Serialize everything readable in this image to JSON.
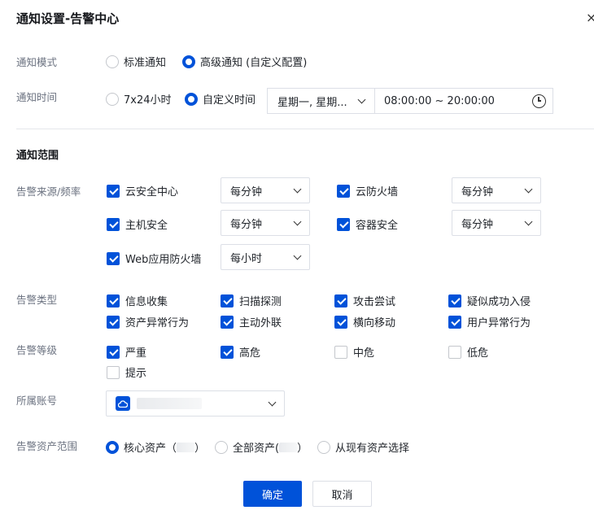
{
  "dialog": {
    "title": "通知设置-告警中心",
    "close_glyph": "×"
  },
  "mode": {
    "label": "通知模式",
    "options": [
      {
        "label": "标准通知",
        "selected": false
      },
      {
        "label": "高级通知 (自定义配置)",
        "selected": true
      }
    ]
  },
  "time": {
    "label": "通知时间",
    "options": [
      {
        "label": "7x24小时",
        "selected": false
      },
      {
        "label": "自定义时间",
        "selected": true
      }
    ],
    "days_value": "星期一, 星期...",
    "range_value": "08:00:00 ~ 20:00:00"
  },
  "scope": {
    "section_title": "通知范围",
    "source_label": "告警来源/频率",
    "sources": [
      {
        "label": "云安全中心",
        "checked": true,
        "frequency": "每分钟"
      },
      {
        "label": "云防火墙",
        "checked": true,
        "frequency": "每分钟"
      },
      {
        "label": "主机安全",
        "checked": true,
        "frequency": "每分钟"
      },
      {
        "label": "容器安全",
        "checked": true,
        "frequency": "每分钟"
      },
      {
        "label": "Web应用防火墙",
        "checked": true,
        "frequency": "每小时"
      }
    ],
    "type_label": "告警类型",
    "types": [
      {
        "label": "信息收集",
        "checked": true
      },
      {
        "label": "扫描探测",
        "checked": true
      },
      {
        "label": "攻击尝试",
        "checked": true
      },
      {
        "label": "疑似成功入侵",
        "checked": true
      },
      {
        "label": "资产异常行为",
        "checked": true
      },
      {
        "label": "主动外联",
        "checked": true
      },
      {
        "label": "横向移动",
        "checked": true
      },
      {
        "label": "用户异常行为",
        "checked": true
      }
    ],
    "level_label": "告警等级",
    "levels": [
      {
        "label": "严重",
        "checked": true
      },
      {
        "label": "高危",
        "checked": true
      },
      {
        "label": "中危",
        "checked": false
      },
      {
        "label": "低危",
        "checked": false
      },
      {
        "label": "提示",
        "checked": false
      }
    ],
    "account_label": "所属账号",
    "asset_label": "告警资产范围",
    "assets": [
      {
        "label": "核心资产（",
        "suffix": "）",
        "selected": true
      },
      {
        "label": "全部资产(",
        "suffix": "）",
        "selected": false
      },
      {
        "label": "从现有资产选择",
        "selected": false
      }
    ]
  },
  "footer": {
    "confirm_label": "确定",
    "cancel_label": "取消"
  },
  "colors": {
    "primary": "#0052d9",
    "border": "#dcdfe6",
    "label": "#6b7280"
  }
}
